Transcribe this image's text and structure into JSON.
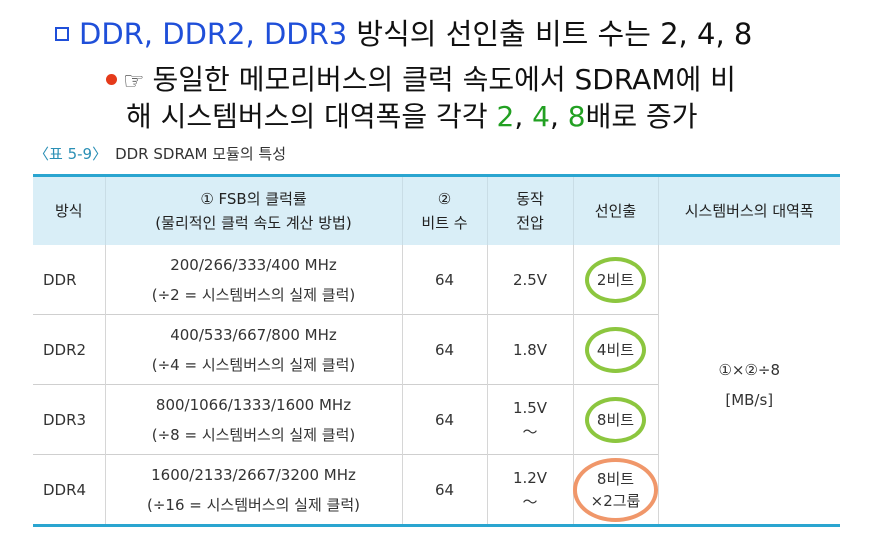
{
  "heading": {
    "types": "DDR, DDR2, DDR3",
    "rest": " 방식의 선인출 비트 수는 2, 4, 8"
  },
  "subtext": {
    "line1": "동일한 메모리버스의 클럭 속도에서 SDRAM에 비",
    "line2_pre": "해 시스템버스의 대역폭을 각각 ",
    "n1": "2",
    "sep1": ", ",
    "n2": "4",
    "sep2": ", ",
    "n3": "8",
    "line2_post": "배로 증가"
  },
  "caption": {
    "label": "〈표 5-9〉",
    "title": "DDR SDRAM 모듈의 특성"
  },
  "table": {
    "headers": {
      "method": "방식",
      "fsb_line1": "① FSB의 클럭률",
      "fsb_line2": "(물리적인 클럭 속도 계산 방법)",
      "bits_line1": "②",
      "bits_line2": "비트 수",
      "volt_line1": "동작",
      "volt_line2": "전압",
      "prefetch": "선인출",
      "bandwidth": "시스템버스의 대역폭"
    },
    "rows": [
      {
        "method": "DDR",
        "fsb1": "200/266/333/400 MHz",
        "fsb2": "(÷2 = 시스템버스의 실제 클럭)",
        "bits": "64",
        "volt": "2.5V",
        "prefetch": "2비트"
      },
      {
        "method": "DDR2",
        "fsb1": "400/533/667/800 MHz",
        "fsb2": "(÷4 = 시스템버스의 실제 클럭)",
        "bits": "64",
        "volt": "1.8V",
        "prefetch": "4비트"
      },
      {
        "method": "DDR3",
        "fsb1": "800/1066/1333/1600 MHz",
        "fsb2": "(÷8 = 시스템버스의 실제 클럭)",
        "bits": "64",
        "volt": "1.5V",
        "volt_tilde": "～",
        "prefetch": "8비트"
      },
      {
        "method": "DDR4",
        "fsb1": "1600/2133/2667/3200 MHz",
        "fsb2": "(÷16 = 시스템버스의 실제 클럭)",
        "bits": "64",
        "volt": "1.2V",
        "volt_tilde": "～",
        "prefetch1": "8비트",
        "prefetch2": "×2그룹"
      }
    ],
    "bandwidth_formula": "①×②÷8",
    "bandwidth_unit": "[MB/s]"
  },
  "colors": {
    "title_blue": "#1f4fd9",
    "bullet_red": "#e53a1a",
    "green_numbers": "#22a022",
    "table_border": "#2aa5d0",
    "header_bg": "#d9eef7",
    "circle_green": "#8cc63f",
    "circle_orange": "#f0976a"
  },
  "icons": [
    "square-bullet-icon",
    "round-bullet-icon",
    "pointing-hand-icon"
  ]
}
